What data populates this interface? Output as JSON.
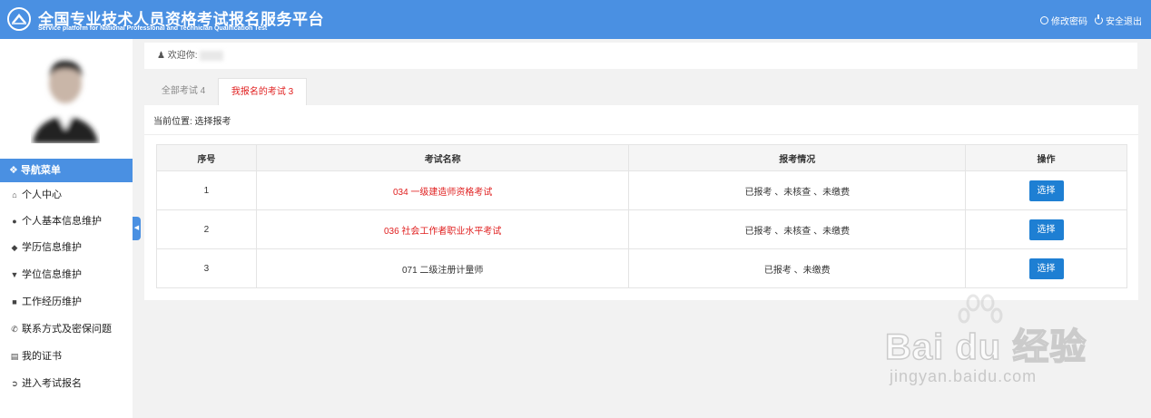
{
  "header": {
    "title_cn": "全国专业技术人员资格考试报名服务平台",
    "title_en": "Service platform for National Professional and Technician Qualification Test",
    "change_password": "修改密码",
    "logout": "安全退出",
    "bg_color": "#4a90e2"
  },
  "sidebar": {
    "nav_title": "导航菜单",
    "items": [
      {
        "label": "个人中心",
        "icon": "home-icon"
      },
      {
        "label": "个人基本信息维护",
        "icon": "user-icon"
      },
      {
        "label": "学历信息维护",
        "icon": "graduation-cap-icon"
      },
      {
        "label": "学位信息维护",
        "icon": "degree-icon"
      },
      {
        "label": "工作经历维护",
        "icon": "briefcase-icon"
      },
      {
        "label": "联系方式及密保问题",
        "icon": "phone-icon"
      },
      {
        "label": "我的证书",
        "icon": "certificate-icon"
      },
      {
        "label": "进入考试报名",
        "icon": "arrow-circle-icon"
      }
    ]
  },
  "welcome": {
    "label": "欢迎你:"
  },
  "tabs": [
    {
      "label": "全部考试 4",
      "active": false
    },
    {
      "label": "我报名的考试 3",
      "active": true
    }
  ],
  "breadcrumb": "当前位置: 选择报考",
  "table": {
    "headers": [
      "序号",
      "考试名称",
      "报考情况",
      "操作"
    ],
    "rows": [
      {
        "no": "1",
        "name": "034 一级建造师资格考试",
        "status": "已报考 、未核查 、未缴费",
        "action": "选择",
        "highlight": true
      },
      {
        "no": "2",
        "name": "036 社会工作者职业水平考试",
        "status": "已报考 、未核查 、未缴费",
        "action": "选择",
        "highlight": true
      },
      {
        "no": "3",
        "name": "071 二级注册计量师",
        "status": "已报考 、未缴费",
        "action": "选择",
        "highlight": false
      }
    ]
  },
  "watermark": {
    "text": "Bai du 经验",
    "url": "jingyan.baidu.com"
  },
  "colors": {
    "accent": "#4a90e2",
    "button": "#1e7fd3",
    "alert": "#e02020"
  }
}
